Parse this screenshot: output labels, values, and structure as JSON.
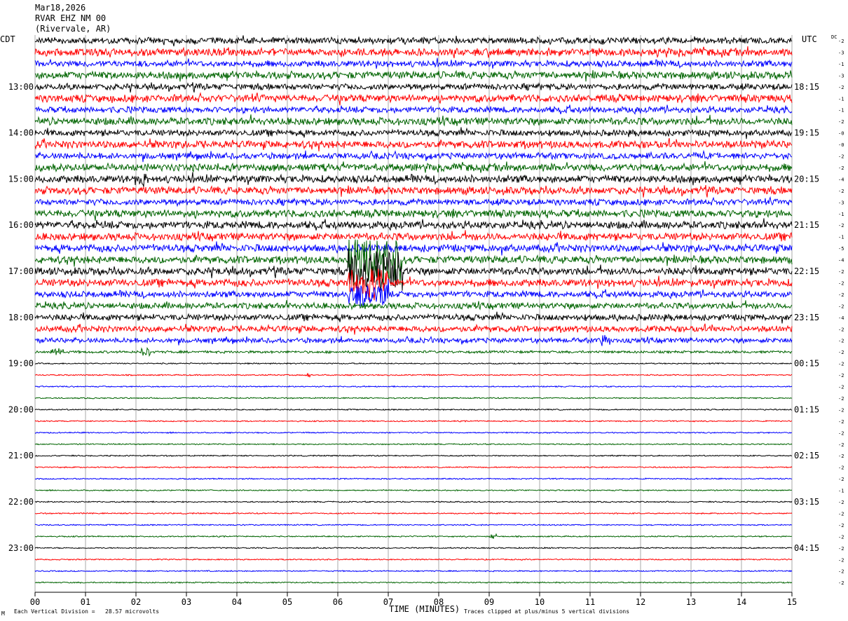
{
  "header": {
    "date": "Mar18,2026",
    "station": "RVAR EHZ NM 00",
    "location": "(Rivervale, AR)"
  },
  "labels": {
    "left_tz": "CDT",
    "right_tz": "UTC",
    "dc": "DC"
  },
  "footer": {
    "left_mark": "M",
    "scale": "Each Vertical Division =   28.57 microvolts",
    "clip": "Traces clipped at plus/minus 5 vertical divisions"
  },
  "chart_data": {
    "type": "line",
    "title": "RVAR EHZ NM 00",
    "xlabel": "TIME (MINUTES)",
    "xlim": [
      0,
      15
    ],
    "x_ticks": [
      "00",
      "01",
      "02",
      "03",
      "04",
      "05",
      "06",
      "07",
      "08",
      "09",
      "10",
      "11",
      "12",
      "13",
      "14",
      "15"
    ],
    "rows_per_hour": 4,
    "trace_colors": [
      "#000000",
      "#ff0000",
      "#0000ff",
      "#006400"
    ],
    "left_hour_labels": [
      "13:00",
      "14:00",
      "15:00",
      "16:00",
      "17:00",
      "18:00",
      "19:00",
      "20:00",
      "21:00",
      "22:00",
      "23:00"
    ],
    "right_hour_labels": [
      "18:15",
      "19:15",
      "20:15",
      "21:15",
      "22:15",
      "23:15",
      "00:15",
      "01:15",
      "02:15",
      "03:15",
      "04:15"
    ],
    "dc_offsets": [
      "-2",
      "-3",
      "-1",
      "-3",
      "-2",
      "-1",
      "-1",
      "-2",
      "-0",
      "-0",
      "-2",
      "-2",
      "-4",
      "-2",
      "-3",
      "-1",
      "-2",
      "-1",
      "-5",
      "-4",
      "-2",
      "-2",
      "-2",
      "-2",
      "-4",
      "-2",
      "-2",
      "-2",
      "-2",
      "-2",
      "-2",
      "-2",
      "-2",
      "-2",
      "-2",
      "-2",
      "-2",
      "-2",
      "-2",
      "-1",
      "-2",
      "-2",
      "-2",
      "-2",
      "-2",
      "-2",
      "-2",
      "-2"
    ],
    "trace_activity": [
      5,
      6,
      5,
      6,
      5,
      6,
      5,
      6,
      5,
      6,
      5,
      6,
      6,
      6,
      5,
      6,
      6,
      6,
      6,
      6,
      6,
      6,
      5,
      5,
      5,
      5,
      4,
      2,
      1,
      1,
      1,
      1,
      1,
      1,
      1,
      1,
      1,
      1,
      1,
      1,
      1,
      1,
      1,
      1,
      1,
      1,
      1,
      1
    ],
    "events": [
      {
        "row": 12,
        "start_min": 2.0,
        "end_min": 2.2,
        "amp": 14
      },
      {
        "row": 19,
        "start_min": 6.2,
        "end_min": 7.3,
        "amp": 40
      },
      {
        "row": 20,
        "start_min": 6.2,
        "end_min": 7.3,
        "amp": 34
      },
      {
        "row": 21,
        "start_min": 6.2,
        "end_min": 7.0,
        "amp": 28
      },
      {
        "row": 22,
        "start_min": 6.2,
        "end_min": 7.0,
        "amp": 22
      },
      {
        "row": 26,
        "start_min": 11.2,
        "end_min": 11.4,
        "amp": 9
      },
      {
        "row": 27,
        "start_min": 0.3,
        "end_min": 0.6,
        "amp": 7
      },
      {
        "row": 27,
        "start_min": 2.1,
        "end_min": 2.3,
        "amp": 7
      },
      {
        "row": 29,
        "start_min": 5.35,
        "end_min": 5.45,
        "amp": 5
      },
      {
        "row": 43,
        "start_min": 9.0,
        "end_min": 9.15,
        "amp": 5
      }
    ]
  }
}
